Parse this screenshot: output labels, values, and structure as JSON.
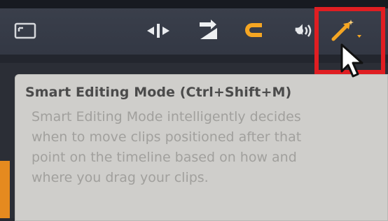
{
  "toolbar": {
    "tools": [
      {
        "name": "screen-icon"
      },
      {
        "name": "split-icon"
      },
      {
        "name": "ripple-edit-icon"
      },
      {
        "name": "magnet-icon"
      },
      {
        "name": "audio-scrub-icon"
      },
      {
        "name": "smart-editing-mode-icon"
      }
    ]
  },
  "colors": {
    "accent": "#f5a623",
    "highlight": "#e01e22",
    "toolbar": "#383d49",
    "tooltip_bg": "#cfcecb"
  },
  "tooltip": {
    "title": "Smart Editing Mode (Ctrl+Shift+M)",
    "body_lines": [
      "Smart Editing Mode intelligently decides",
      "when to move clips positioned after that",
      "point on the timeline based on how and",
      "where you drag your clips."
    ]
  }
}
